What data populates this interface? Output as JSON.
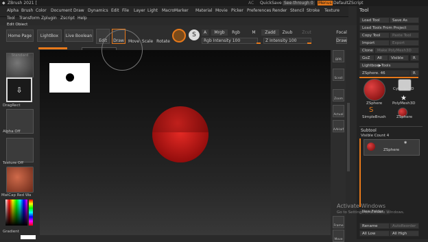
{
  "title": "ZBrush 2021 [",
  "titlebar": {
    "ac": "AC",
    "quicksave": "QuickSave",
    "see_through": "See-through  0",
    "menus": "Menus",
    "script": "DefaultZScript"
  },
  "menus": [
    "Alpha",
    "Brush",
    "Color",
    "Document",
    "Draw",
    "Dynamics",
    "Edit",
    "File",
    "Layer",
    "Light",
    "Macro",
    "Marker",
    "Material",
    "Movie",
    "Picker",
    "Preferences",
    "Render",
    "Stencil",
    "Stroke",
    "Texture"
  ],
  "menus2": [
    "Tool",
    "Transform",
    "Zplugin",
    "Zscript",
    "Help"
  ],
  "edit_object_label": "Edit Object",
  "toolbar": {
    "home": "Home Page",
    "lightbox": "LightBox",
    "live_boolean": "Live Boolean",
    "edit": "Edit",
    "draw": "Draw",
    "move": "Move",
    "scale": "Scale",
    "rotate": "Rotate",
    "a": "A",
    "mrgb": "Mrgb",
    "rgb": "Rgb",
    "m": "M",
    "zadd": "Zadd",
    "zsub": "Zsub",
    "zcut": "Zcut",
    "rgb_intensity": "Rgb Intensity 100",
    "z_intensity": "Z Intensity 100",
    "focal": "Focal",
    "draw2": "Draw"
  },
  "tooltip": "Edit Object  T",
  "left": {
    "standard": "Standard",
    "dragrect": "DragRect",
    "alpha_off": "Alpha Off",
    "texture_off": "Texture Off",
    "matcap": "MatCap Red Wa",
    "gradient": "Gradient"
  },
  "strip": [
    "BPR",
    "Scroll",
    "Zoom",
    "Actual",
    "AAHalf",
    "Frame",
    "Move"
  ],
  "right": {
    "tool": "Tool",
    "load_tool": "Load Tool",
    "save_as": "Save As",
    "load_tools_project": "Load Tools From Project",
    "copy_tool": "Copy Tool",
    "paste_tool": "Paste Tool",
    "import": "Import",
    "export": "Export",
    "clone": "Clone",
    "make_polymesh": "Make PolyMesh3D",
    "goz": "GoZ",
    "all": "All",
    "visible": "Visible",
    "r": "R",
    "lightbox_tools": "Lightbox▶Tools",
    "zsphere_46": "ZSphere. 46",
    "r2": "R",
    "zsphere": "ZSphere",
    "cylinder3d": "Cylinder3D",
    "polymesh3d": "PolyMesh3D",
    "simplebrush": "SimpleBrush",
    "zsphere2": "ZSphere",
    "subtool": "Subtool",
    "visible_count": "Visible Count 4",
    "zsphere_sub": "ZSphere",
    "new_folder": "New Folder",
    "rename": "Rename",
    "autoreorder": "AutoReorder",
    "all_low": "All Low",
    "all_high": "All High"
  },
  "watermark": {
    "line1": "Activate Windows",
    "line2": "Go to Settings to activate Windows."
  },
  "colors": {
    "accent": "#e8791a",
    "sphere": "#b01818"
  }
}
